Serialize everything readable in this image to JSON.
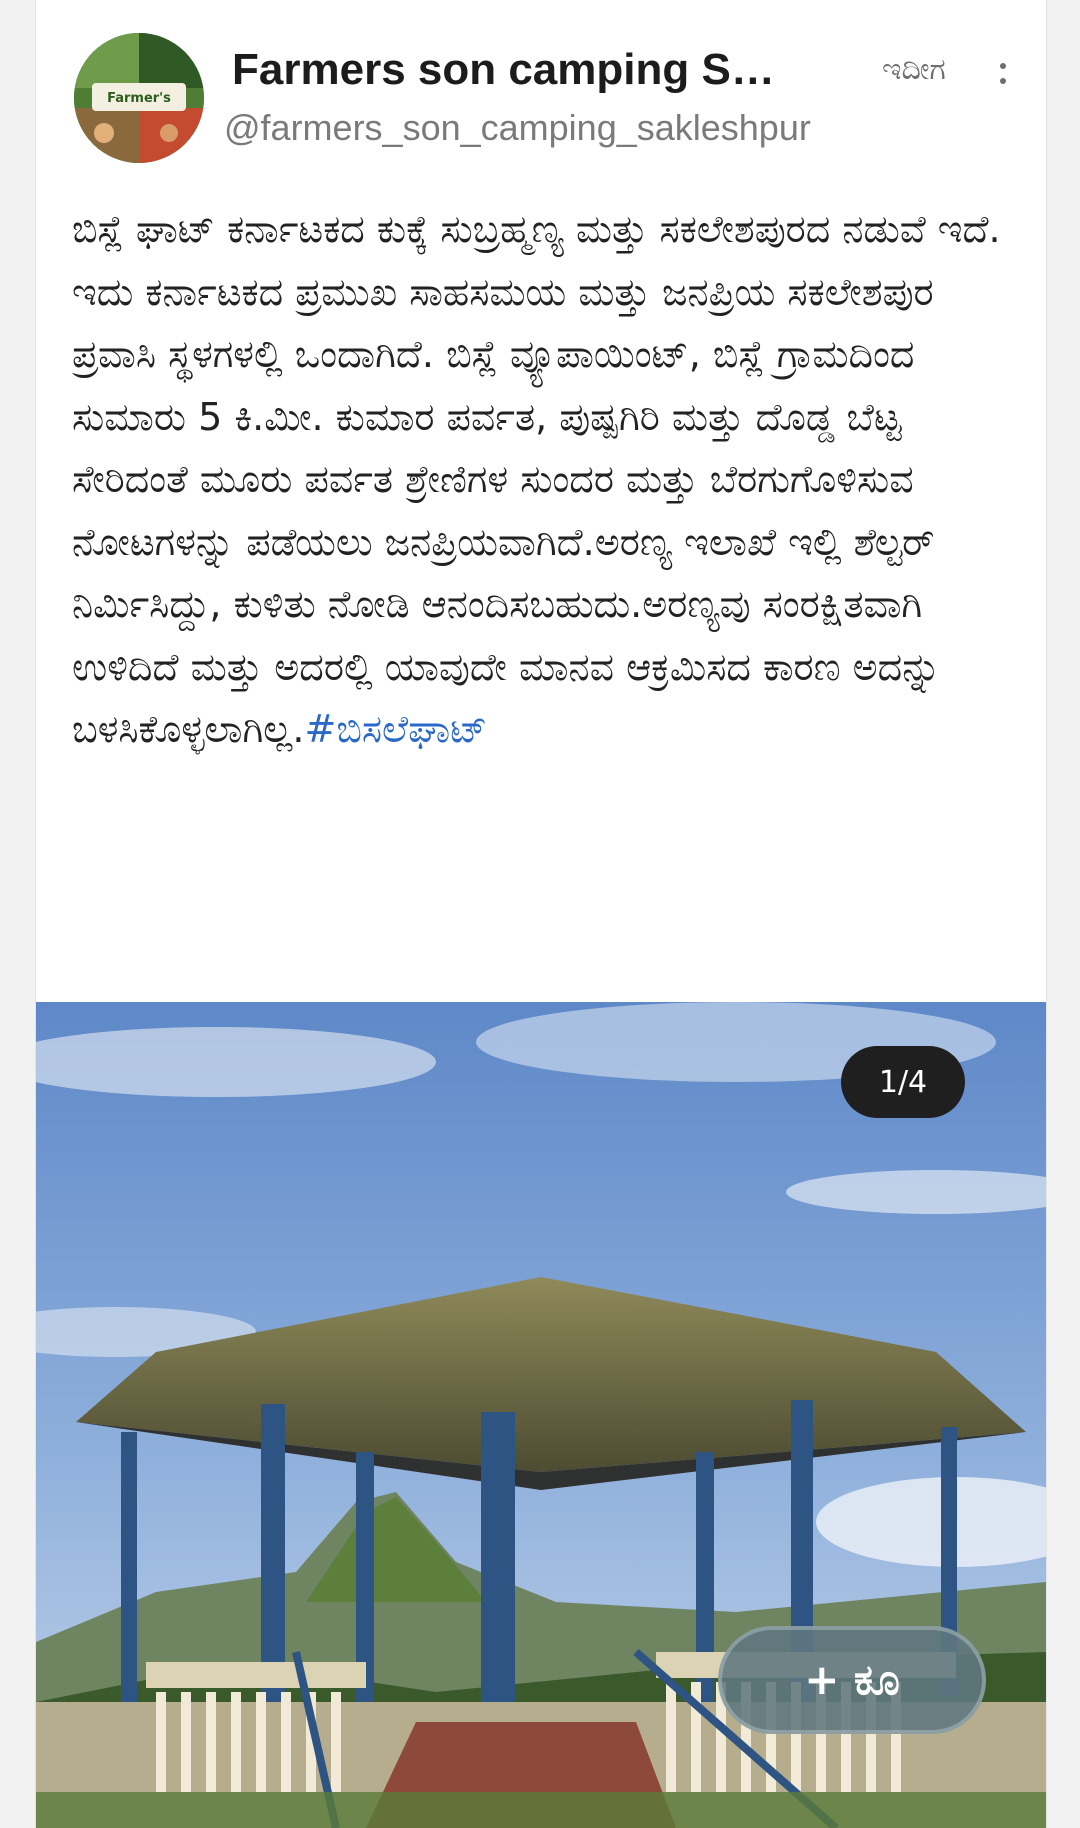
{
  "post": {
    "display_name": "Farmers son camping Sakl...",
    "handle": "@farmers_son_camping_sakleshpur",
    "timestamp": "ಇದೀಗ",
    "avatar_text": "Farmer's",
    "body": "ಬಿಸ್ಲೆ ಘಾಟ್ ಕರ್ನಾಟಕದ ಕುಕ್ಕೆ ಸುಬ್ರಹ್ಮಣ್ಯ ಮತ್ತು ಸಕಲೇಶಪುರದ ನಡುವೆ ಇದೆ. ಇದು ಕರ್ನಾಟಕದ ಪ್ರಮುಖ ಸಾಹಸಮಯ ಮತ್ತು  ಜನಪ್ರಿಯ ಸಕಲೇಶಪುರ ಪ್ರವಾಸಿ ಸ್ಥಳಗಳಲ್ಲಿ ಒಂದಾಗಿದೆ. ಬಿಸ್ಲೆ ವ್ಯೂಪಾಯಿಂಟ್, ಬಿಸ್ಲೆ ಗ್ರಾಮದಿಂದ ಸುಮಾರು 5 ಕಿ.ಮೀ. ಕುಮಾರ ಪರ್ವತ, ಪುಷ್ಪಗಿರಿ ಮತ್ತು ದೊಡ್ಡ ಬೆಟ್ಟ ಸೇರಿದಂತೆ ಮೂರು ಪರ್ವತ ಶ್ರೇಣಿಗಳ ಸುಂದರ ಮತ್ತು ಬೆರಗುಗೊಳಿಸುವ ನೋಟಗಳನ್ನು ಪಡೆಯಲು  ಜನಪ್ರಿಯವಾಗಿದೆ.ಅರಣ್ಯ ಇಲಾಖೆ ಇಲ್ಲಿ ಶೆಲ್ಟರ್ ನಿರ್ಮಿಸಿದ್ದು, ಕುಳಿತು ನೋಡಿ ಆನಂದಿಸಬಹುದು.ಅರಣ್ಯವು ಸಂರಕ್ಷಿತವಾಗಿ ಉಳಿದಿದೆ ಮತ್ತು ಅದರಲ್ಲಿ ಯಾವುದೇ ಮಾನವ ಆಕ್ರಮಿಸದ ಕಾರಣ ಅದನ್ನು ಬಳಸಿಕೊಳ್ಳಲಾಗಿಲ್ಲ.",
    "hashtag": "#ಬಿಸಲೆಘಾಟ್",
    "media_counter": "1/4"
  },
  "follow_button": {
    "label": "+ ಕೂ"
  },
  "icons": {
    "more": "more-vertical-icon"
  },
  "colors": {
    "hashtag": "#2a69c9",
    "counter_bg": "#1f1f1f",
    "follow_bg": "#607780"
  }
}
